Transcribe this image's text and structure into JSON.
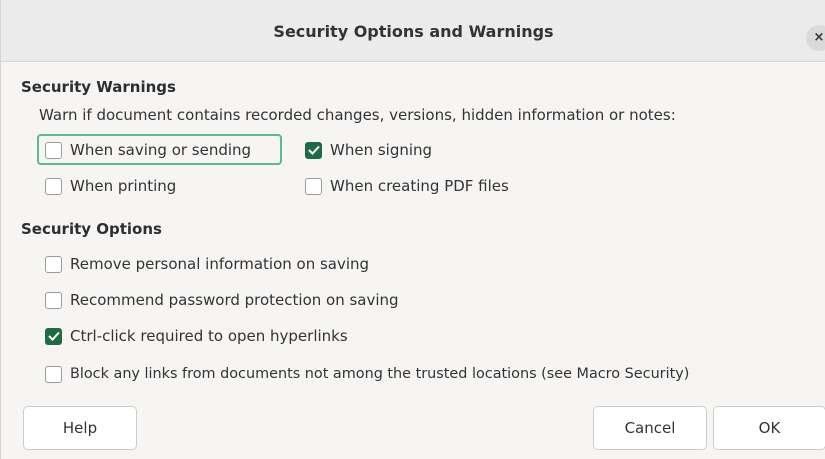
{
  "window": {
    "title": "Security Options and Warnings",
    "close_label": "×"
  },
  "security_warnings": {
    "heading": "Security Warnings",
    "description": "Warn if document contains recorded changes, versions, hidden information or notes:",
    "options": [
      {
        "label": "When saving or sending",
        "checked": false,
        "focused": true
      },
      {
        "label": "When signing",
        "checked": true
      },
      {
        "label": "When printing",
        "checked": false
      },
      {
        "label": "When creating PDF files",
        "checked": false
      }
    ]
  },
  "security_options": {
    "heading": "Security Options",
    "options": [
      {
        "label": "Remove personal information on saving",
        "checked": false
      },
      {
        "label": "Recommend password protection on saving",
        "checked": false
      },
      {
        "label": "Ctrl-click required to open hyperlinks",
        "checked": true
      },
      {
        "label": "Block any links from documents not among the trusted locations (see Macro Security)",
        "checked": false
      }
    ]
  },
  "buttons": {
    "help": "Help",
    "cancel": "Cancel",
    "ok": "OK"
  },
  "colors": {
    "accent": "#1e6b45",
    "focus": "#5fb98c"
  }
}
